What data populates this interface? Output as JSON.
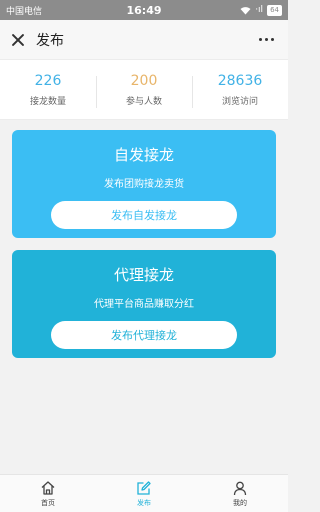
{
  "status": {
    "carrier": "中国电信",
    "time": "16:49",
    "signal": "·ıl",
    "battery": "64"
  },
  "header": {
    "title": "发布"
  },
  "stats": [
    {
      "value": "226",
      "label": "接龙数量",
      "color": "#42b2e6"
    },
    {
      "value": "200",
      "label": "参与人数",
      "color": "#e8b56a"
    },
    {
      "value": "28636",
      "label": "浏览访问",
      "color": "#42b2e6"
    }
  ],
  "cards": [
    {
      "title": "自发接龙",
      "subtitle": "发布团购接龙卖货",
      "button": "发布自发接龙",
      "bg": "#3bbef3",
      "button_text_color": "#3bbef3"
    },
    {
      "title": "代理接龙",
      "subtitle": "代理平台商品赚取分红",
      "button": "发布代理接龙",
      "bg": "#21b2d8",
      "button_text_color": "#21b2d8"
    }
  ],
  "tabbar": {
    "items": [
      {
        "label": "首页",
        "icon": "home-icon",
        "active": false
      },
      {
        "label": "发布",
        "icon": "edit-icon",
        "active": true
      },
      {
        "label": "我的",
        "icon": "user-icon",
        "active": false
      }
    ],
    "active_color": "#21b2d8",
    "inactive_color": "#444444"
  }
}
